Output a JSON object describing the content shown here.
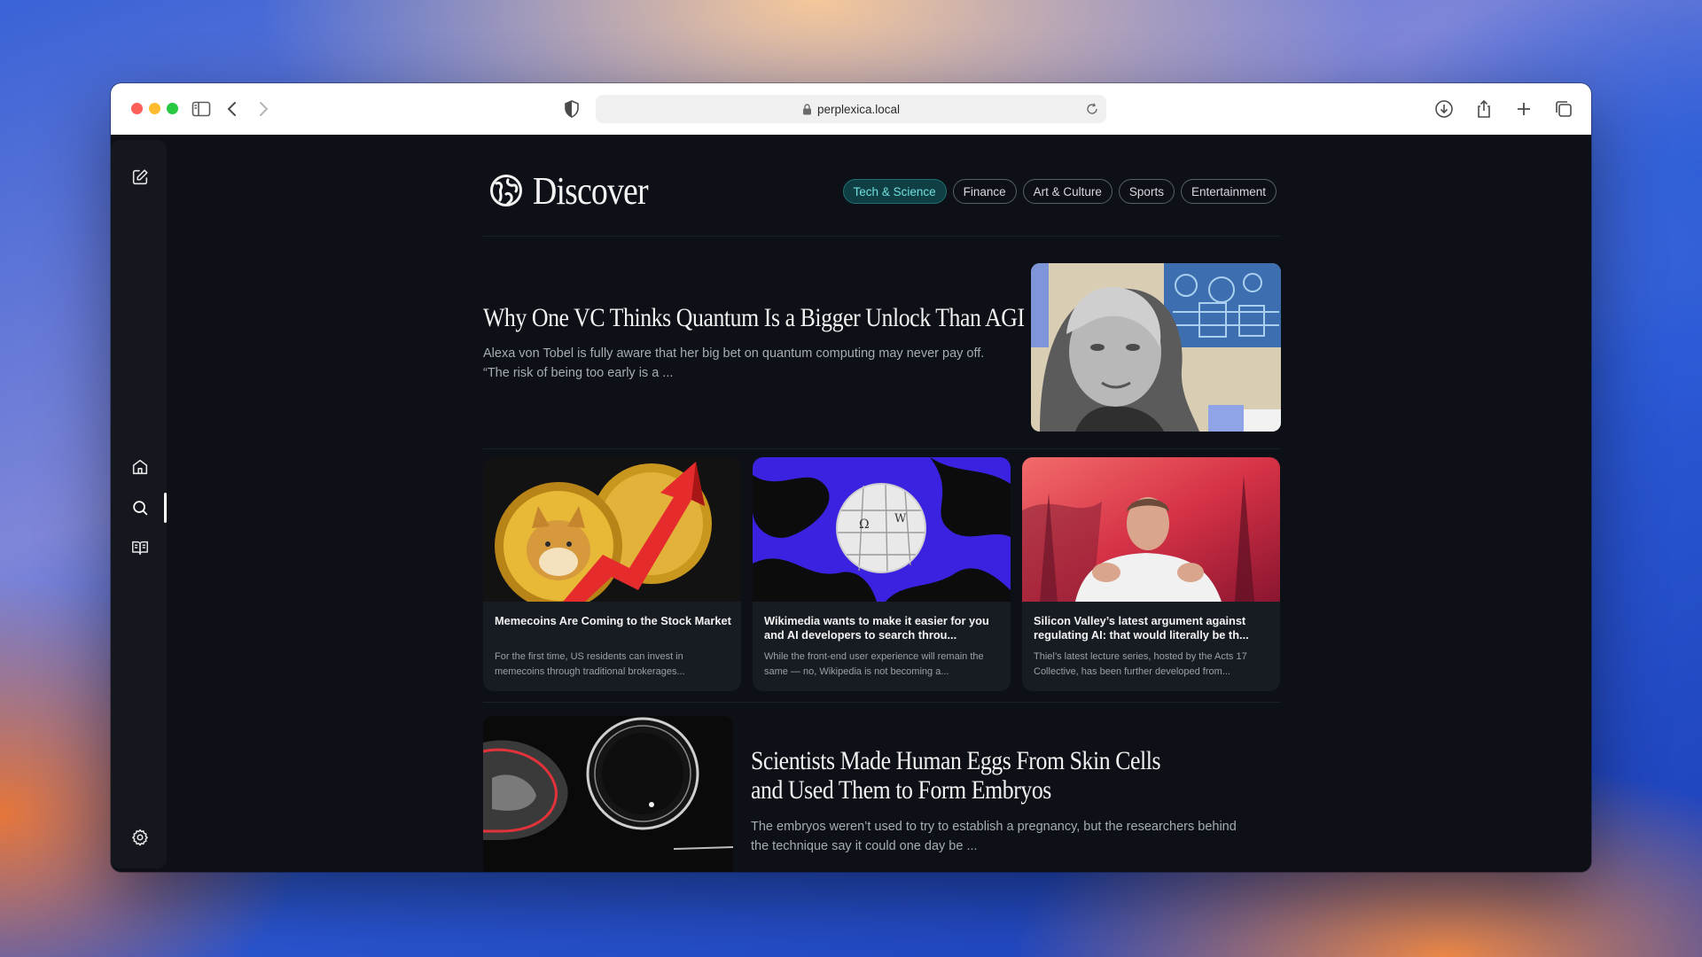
{
  "browser": {
    "url": "perplexica.local",
    "traffic_lights": {
      "close": "#fe5f57",
      "minimize": "#febc2e",
      "zoom": "#28c840"
    }
  },
  "sidebar": {
    "items": [
      "new-chat-icon",
      "home-icon",
      "search-icon",
      "library-icon"
    ],
    "settings": "gear-icon",
    "active": "search"
  },
  "discover": {
    "title": "Discover",
    "topics": [
      {
        "label": "Tech & Science",
        "active": true
      },
      {
        "label": "Finance",
        "active": false
      },
      {
        "label": "Art & Culture",
        "active": false
      },
      {
        "label": "Sports",
        "active": false
      },
      {
        "label": "Entertainment",
        "active": false
      }
    ]
  },
  "articles": {
    "hero": {
      "title": "Why One VC Thinks Quantum Is a Bigger Unlock Than AGI",
      "description": "Alexa von Tobel is fully aware that her big bet on quantum computing may never pay off. “The risk of being too early is a ..."
    },
    "cards": [
      {
        "title": "Memecoins Are Coming to the Stock Market",
        "description": "For the first time, US residents can invest in memecoins through traditional brokerages..."
      },
      {
        "title": "Wikimedia wants to make it easier for you and AI developers to search throu...",
        "description": "While the front-end user experience will remain the same — no, Wikipedia is not becoming a..."
      },
      {
        "title": "Silicon Valley’s latest argument against regulating AI: that would literally be th...",
        "description": "Thiel’s latest lecture series, hosted by the Acts 17 Collective, has been further developed from..."
      }
    ],
    "bottom": {
      "title": "Scientists Made Human Eggs From Skin Cells and Used Them to Form Embryos",
      "description": "The embryos weren’t used to try to establish a pregnancy, but the researchers behind the technique say it could one day be ..."
    }
  }
}
